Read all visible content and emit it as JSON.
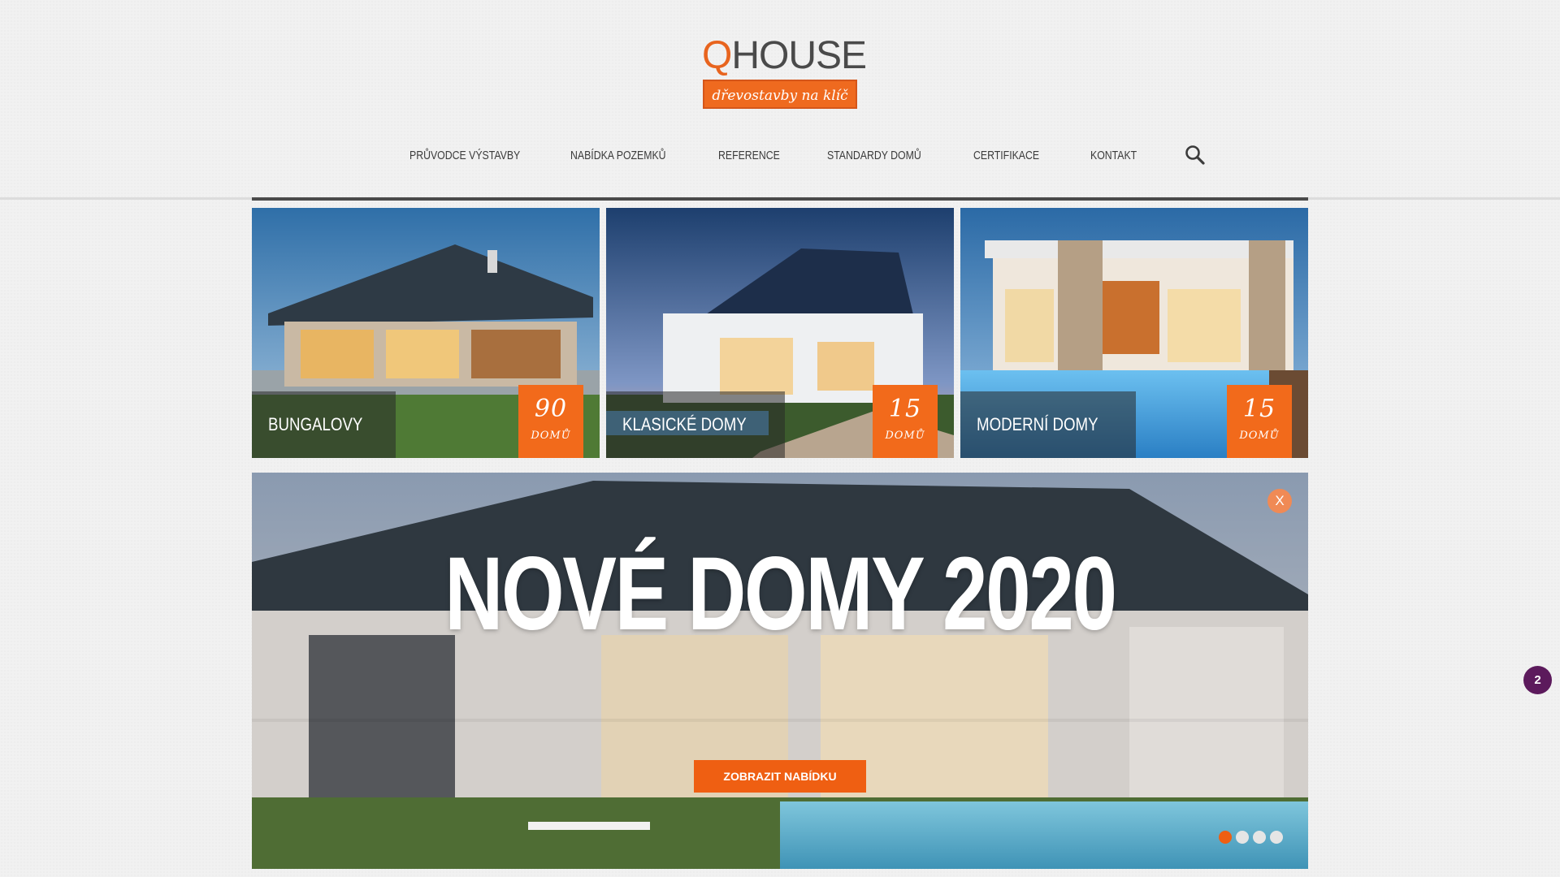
{
  "logo": {
    "word_q": "Q",
    "word_rest": "HOUSE",
    "tagline": "dřevostavby na klíč"
  },
  "nav": {
    "items": [
      {
        "label": "PRŮVODCE VÝSTAVBY"
      },
      {
        "label": "NABÍDKA POZEMKŮ"
      },
      {
        "label": "REFERENCE"
      },
      {
        "label": "STANDARDY DOMŮ"
      },
      {
        "label": "CERTIFIKACE"
      },
      {
        "label": "KONTAKT"
      }
    ],
    "search_icon": "search-icon"
  },
  "categories": [
    {
      "label": "BUNGALOVY",
      "count": "90",
      "unit": "DOMŮ"
    },
    {
      "label": "KLASICKÉ DOMY",
      "count": "15",
      "unit": "DOMŮ"
    },
    {
      "label": "MODERNÍ DOMY",
      "count": "15",
      "unit": "DOMŮ"
    }
  ],
  "banner": {
    "title": "NOVÉ DOMY 2020",
    "cta": "ZOBRAZIT NABÍDKU",
    "close": "X",
    "slides_total": 4,
    "active_slide": 1
  },
  "chat": {
    "badge": "2"
  },
  "colors": {
    "accent": "#ef6a1f",
    "nav_text": "#3b3b3b",
    "background": "#f1f1f1",
    "chat": "#5c1a5c"
  }
}
